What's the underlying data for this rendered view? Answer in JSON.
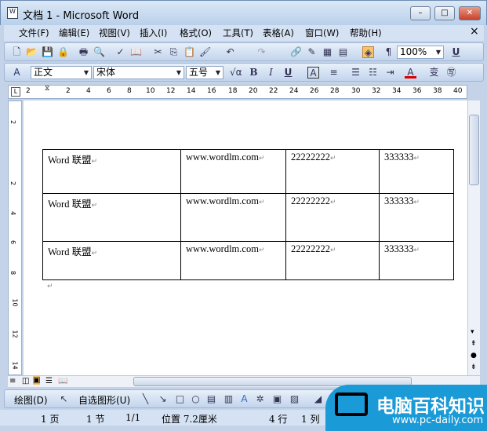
{
  "window": {
    "title": "文档 1 - Microsoft Word",
    "min": "–",
    "max": "□",
    "close": "✕"
  },
  "menu": [
    "文件(F)",
    "编辑(E)",
    "视图(V)",
    "插入(I)",
    "格式(O)",
    "工具(T)",
    "表格(A)",
    "窗口(W)",
    "帮助(H)"
  ],
  "menu_close": "×",
  "toolbar": {
    "zoom": "100%",
    "underline": "U"
  },
  "format": {
    "style": "正文",
    "font": "宋体",
    "size": "五号",
    "bold": "B",
    "italic": "I",
    "underline": "U",
    "border_char": "A",
    "font_color": "A"
  },
  "ruler": {
    "ticks": [
      "2",
      "2",
      "4",
      "6",
      "8",
      "10",
      "12",
      "14",
      "16",
      "18",
      "20",
      "22",
      "24",
      "26",
      "28",
      "30",
      "32",
      "34",
      "36",
      "38",
      "40"
    ],
    "vticks": [
      "2",
      "2",
      "4",
      "6",
      "8",
      "10",
      "12",
      "14"
    ]
  },
  "table": {
    "rows": [
      [
        "Word 联盟",
        "www.wordlm.com",
        "22222222",
        "333333"
      ],
      [
        "Word 联盟",
        "www.wordlm.com",
        "22222222",
        "333333"
      ],
      [
        "Word 联盟",
        "www.wordlm.com",
        "22222222",
        "333333"
      ]
    ],
    "mark": "↵"
  },
  "drawbar": {
    "draw": "绘图(D)",
    "autoshape": "自选图形(U)"
  },
  "status": {
    "page": "1 页",
    "section": "1 节",
    "pages": "1/1",
    "position": "位置 7.2厘米",
    "line": "4 行",
    "col": "1 列"
  },
  "watermark": {
    "text": "电脑百科知识",
    "url": "www.pc-daily.com"
  },
  "colors": {
    "accent": "#1a9ad6",
    "chrome": "#c4d3e8"
  }
}
